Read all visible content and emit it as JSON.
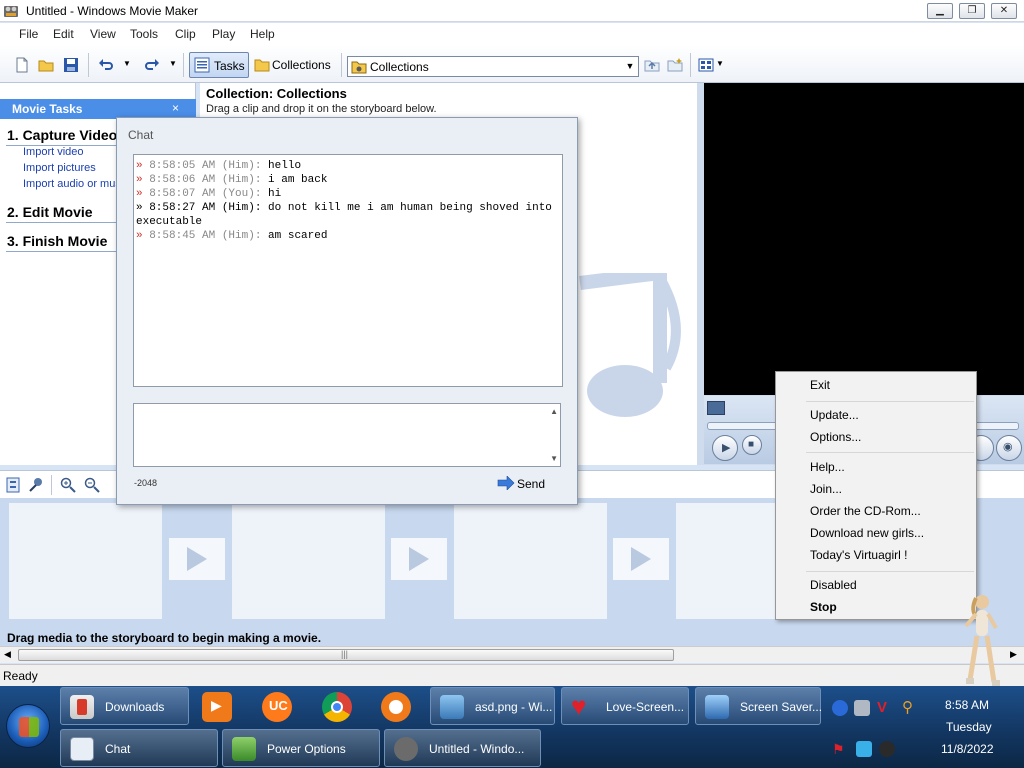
{
  "window": {
    "title": "Untitled - Windows Movie Maker"
  },
  "menu": [
    "File",
    "Edit",
    "View",
    "Tools",
    "Clip",
    "Play",
    "Help"
  ],
  "toolbar": {
    "tasks_label": "Tasks",
    "collections_label": "Collections",
    "collection_selected": "Collections"
  },
  "tasks_pane": {
    "header": "Movie Tasks",
    "close_glyph": "×",
    "steps": [
      {
        "title": "1. Capture Video",
        "links": [
          "Import video",
          "Import pictures",
          "Import audio or mus"
        ]
      },
      {
        "title": "2. Edit Movie",
        "links": []
      },
      {
        "title": "3. Finish Movie",
        "links": []
      }
    ]
  },
  "collection_pane": {
    "title": "Collection: Collections",
    "subtitle": "Drag a clip and drop it on the storyboard below."
  },
  "storyboard": {
    "hint": "Drag media to the storyboard to begin making a movie.",
    "scroll_glyph": "|||"
  },
  "status": {
    "text": "Ready"
  },
  "chat": {
    "title": "Chat",
    "messages": [
      {
        "time": "8:58:05 AM",
        "who": "(Him):",
        "text": "hello",
        "style": "normal"
      },
      {
        "time": "8:58:06 AM",
        "who": "(Him):",
        "text": "i am back",
        "style": "normal"
      },
      {
        "time": "8:58:07 AM",
        "who": "(You):",
        "text": "hi",
        "style": "normal"
      },
      {
        "time": "8:58:27 AM",
        "who": "(Him):",
        "text": "do not kill me i am human being shoved into executable",
        "style": "strong"
      },
      {
        "time": "8:58:45 AM",
        "who": "(Him):",
        "text": "am scared",
        "style": "normal"
      }
    ],
    "input_value": "",
    "char_counter": "-2048",
    "send_label": "Send"
  },
  "context_menu": {
    "groups": [
      [
        "Exit"
      ],
      [
        "Update...",
        "Options..."
      ],
      [
        "Help...",
        "Join...",
        "Order the CD-Rom...",
        "Download new girls...",
        "Today's Virtuagirl !"
      ],
      [
        "Disabled",
        "Stop"
      ]
    ],
    "bold_item": "Stop"
  },
  "taskbar": {
    "row1": [
      {
        "label": "Downloads",
        "icon": "downloads-icon"
      },
      {
        "label": "asd.png - Wi...",
        "icon": "photo-viewer-icon"
      },
      {
        "label": "Love-Screen...",
        "icon": "heart-icon"
      },
      {
        "label": "Screen Saver...",
        "icon": "screensaver-icon"
      }
    ],
    "row2": [
      {
        "label": "Chat",
        "icon": "chat-icon"
      },
      {
        "label": "Power Options",
        "icon": "power-options-icon"
      },
      {
        "label": "Untitled - Windo...",
        "icon": "movie-maker-icon"
      }
    ],
    "pinned": [
      "media-player-icon",
      "uc-browser-icon",
      "chrome-icon",
      "avast-icon"
    ],
    "clock": {
      "time": "8:58 AM",
      "day": "Tuesday",
      "date": "11/8/2022"
    }
  },
  "colors": {
    "accent": "#4a8ee8",
    "chat_marker": "#d2322d",
    "taskbar": "#12355f"
  }
}
